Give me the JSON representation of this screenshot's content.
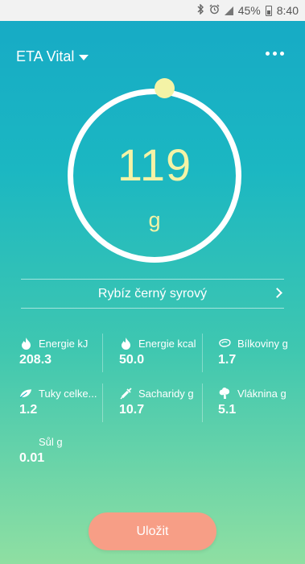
{
  "status_bar": {
    "battery_percent": "45%",
    "time": "8:40",
    "icons": [
      "bluetooth-icon",
      "alarm-icon",
      "signal-icon",
      "battery-icon"
    ]
  },
  "header": {
    "title": "ETA Vital",
    "menu_icon": "more-dots-icon"
  },
  "dial": {
    "value": "119",
    "unit": "g"
  },
  "food": {
    "name": "Rybíz černý syrový"
  },
  "nutrients": [
    {
      "label": "Energie kJ",
      "value": "208.3",
      "icon": "flame-icon"
    },
    {
      "label": "Energie kcal",
      "value": "50.0",
      "icon": "flame-icon"
    },
    {
      "label": "Bílkoviny g",
      "value": "1.7",
      "icon": "meat-icon"
    },
    {
      "label": "Tuky celke...",
      "value": "1.2",
      "icon": "leaf-icon"
    },
    {
      "label": "Sacharidy g",
      "value": "10.7",
      "icon": "syringe-icon"
    },
    {
      "label": "Vláknina g",
      "value": "5.1",
      "icon": "broccoli-icon"
    },
    {
      "label": "Sůl g",
      "value": "0.01",
      "icon": ""
    }
  ],
  "actions": {
    "save_label": "Uložit"
  },
  "colors": {
    "accent_yellow": "#f4f3a6",
    "save_button": "#f79e86",
    "gradient_top": "#16a9c6",
    "gradient_bottom": "#8fdfa2"
  }
}
